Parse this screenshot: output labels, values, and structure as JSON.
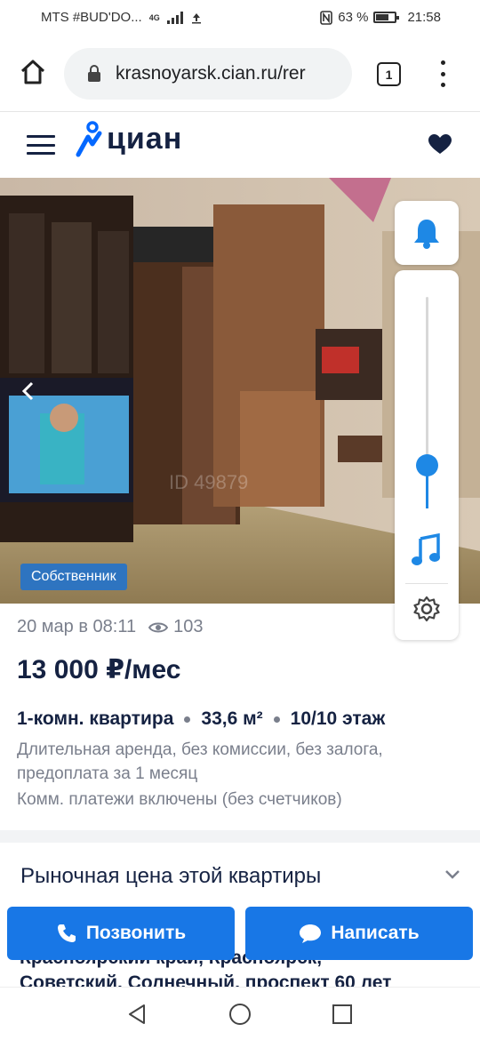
{
  "status_bar": {
    "carrier": "MTS #BUD'DO...",
    "network": "4G",
    "battery_percent": "63 %",
    "time": "21:58"
  },
  "browser": {
    "url": "krasnoyarsk.cian.ru/rer",
    "tab_count": "1"
  },
  "site": {
    "logo_text": "циан",
    "brand_color": "#0468ff"
  },
  "listing": {
    "badge": "Собственник",
    "date": "20 мар в 08:11",
    "views": "103",
    "price": "13 000 ₽/мес",
    "rooms": "1-комн. квартира",
    "area": "33,6 м²",
    "floor": "10/10 этаж",
    "terms_line1": "Длительная аренда, без комиссии, без залога,",
    "terms_line2": "предоплата за 1 месяц",
    "utilities": "Комм. платежи включены (без счетчиков)",
    "market_price_title": "Рыночная цена этой квартиры",
    "address_line1": "Красноярский край, Красноярск,",
    "address_line2": "Советский, Солнечный, проспект 60 лет"
  },
  "volume": {
    "level": 0.1
  },
  "actions": {
    "call_label": "Позвонить",
    "write_label": "Написать"
  }
}
